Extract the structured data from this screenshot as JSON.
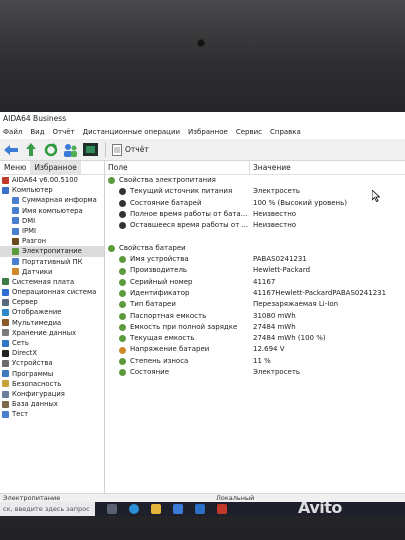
{
  "app": {
    "title": "AIDA64 Business"
  },
  "menu": [
    "Файл",
    "Вид",
    "Отчёт",
    "Дистанционные операции",
    "Избранное",
    "Сервис",
    "Справка"
  ],
  "toolbar": {
    "report_label": "Отчёт"
  },
  "columns": {
    "tab_menu": "Меню",
    "tab_favorites": "Избранное",
    "field": "Поле",
    "value": "Значение"
  },
  "tree": [
    {
      "label": "AIDA64 v6.00.5100",
      "indent": 0,
      "icon": "aida-icon",
      "color": "#c0392b"
    },
    {
      "label": "Компьютер",
      "indent": 0,
      "icon": "computer-icon",
      "color": "#3b6fc9"
    },
    {
      "label": "Суммарная информа",
      "indent": 1,
      "icon": "summary-icon",
      "color": "#4a7fd0"
    },
    {
      "label": "Имя компьютера",
      "indent": 1,
      "icon": "name-icon",
      "color": "#4a7fd0"
    },
    {
      "label": "DMI",
      "indent": 1,
      "icon": "dmi-icon",
      "color": "#4a7fd0"
    },
    {
      "label": "IPMI",
      "indent": 1,
      "icon": "ipmi-icon",
      "color": "#4a7fd0"
    },
    {
      "label": "Разгон",
      "indent": 1,
      "icon": "overclock-icon",
      "color": "#6b4a1f"
    },
    {
      "label": "Электропитание",
      "indent": 1,
      "icon": "power-icon",
      "color": "#5d9a3b",
      "selected": true
    },
    {
      "label": "Портативный ПК",
      "indent": 1,
      "icon": "laptop-icon",
      "color": "#4a7fd0"
    },
    {
      "label": "Датчики",
      "indent": 1,
      "icon": "sensor-icon",
      "color": "#d08a2a"
    },
    {
      "label": "Системная плата",
      "indent": 0,
      "icon": "motherboard-icon",
      "color": "#3d7c47"
    },
    {
      "label": "Операционная система",
      "indent": 0,
      "icon": "os-icon",
      "color": "#2f6fd6"
    },
    {
      "label": "Сервер",
      "indent": 0,
      "icon": "server-icon",
      "color": "#5a6b80"
    },
    {
      "label": "Отображение",
      "indent": 0,
      "icon": "display-icon",
      "color": "#2d88c9"
    },
    {
      "label": "Мультимедиа",
      "indent": 0,
      "icon": "multimedia-icon",
      "color": "#8a5a2a"
    },
    {
      "label": "Хранение данных",
      "indent": 0,
      "icon": "storage-icon",
      "color": "#7a7a7a"
    },
    {
      "label": "Сеть",
      "indent": 0,
      "icon": "network-icon",
      "color": "#2f77c7"
    },
    {
      "label": "DirectX",
      "indent": 0,
      "icon": "directx-icon",
      "color": "#222222"
    },
    {
      "label": "Устройства",
      "indent": 0,
      "icon": "devices-icon",
      "color": "#6b6b6b"
    },
    {
      "label": "Программы",
      "indent": 0,
      "icon": "programs-icon",
      "color": "#3d7bbf"
    },
    {
      "label": "Безопасность",
      "indent": 0,
      "icon": "security-icon",
      "color": "#c7a43a"
    },
    {
      "label": "Конфигурация",
      "indent": 0,
      "icon": "config-icon",
      "color": "#6a7f9a"
    },
    {
      "label": "База данных",
      "indent": 0,
      "icon": "database-icon",
      "color": "#7a6a4a"
    },
    {
      "label": "Тест",
      "indent": 0,
      "icon": "test-icon",
      "color": "#4a7fd0"
    }
  ],
  "rows": [
    {
      "type": "group",
      "field": "Свойства электропитания",
      "value": "",
      "icon": "power-props-icon",
      "color": "#5d9a3b"
    },
    {
      "type": "item",
      "field": "Текущий источник питания",
      "value": "Электросеть",
      "icon": "plug-icon",
      "color": "#333333"
    },
    {
      "type": "item",
      "field": "Состояние батарей",
      "value": "100 % (Высокий уровень)",
      "icon": "battery-icon",
      "color": "#333333"
    },
    {
      "type": "item",
      "field": "Полное время работы от бата...",
      "value": "Неизвестно",
      "icon": "battery-time-icon",
      "color": "#333333"
    },
    {
      "type": "item",
      "field": "Оставшееся время работы от ...",
      "value": "Неизвестно",
      "icon": "battery-remaining-icon",
      "color": "#333333"
    },
    {
      "type": "spacer",
      "field": "",
      "value": ""
    },
    {
      "type": "group",
      "field": "Свойства батареи",
      "value": "",
      "icon": "battery-props-icon",
      "color": "#5d9a3b"
    },
    {
      "type": "item",
      "field": "Имя устройства",
      "value": "PABAS0241231",
      "icon": "device-name-icon",
      "color": "#5d9a3b"
    },
    {
      "type": "item",
      "field": "Производитель",
      "value": "Hewlett-Packard",
      "icon": "manufacturer-icon",
      "color": "#5d9a3b"
    },
    {
      "type": "item",
      "field": "Серийный номер",
      "value": "41167",
      "icon": "serial-icon",
      "color": "#5d9a3b"
    },
    {
      "type": "item",
      "field": "Идентификатор",
      "value": "41167Hewlett-PackardPABAS0241231",
      "icon": "id-icon",
      "color": "#5d9a3b"
    },
    {
      "type": "item",
      "field": "Тип батареи",
      "value": "Перезаряжаемая Li-Ion",
      "icon": "battery-type-icon",
      "color": "#5d9a3b"
    },
    {
      "type": "item",
      "field": "Паспортная емкость",
      "value": "31080 mWh",
      "icon": "design-capacity-icon",
      "color": "#5d9a3b"
    },
    {
      "type": "item",
      "field": "Емкость при полной зарядке",
      "value": "27484 mWh",
      "icon": "full-capacity-icon",
      "color": "#5d9a3b"
    },
    {
      "type": "item",
      "field": "Текущая емкость",
      "value": "27484 mWh  (100 %)",
      "icon": "current-capacity-icon",
      "color": "#5d9a3b"
    },
    {
      "type": "item",
      "field": "Напряжение батареи",
      "value": "12.694 V",
      "icon": "voltage-icon",
      "color": "#d08a2a"
    },
    {
      "type": "item",
      "field": "Степень износа",
      "value": "11 %",
      "icon": "wear-icon",
      "color": "#5d9a3b"
    },
    {
      "type": "item",
      "field": "Состояние",
      "value": "Электросеть",
      "icon": "state-icon",
      "color": "#5d9a3b"
    }
  ],
  "status": {
    "left": "Электропитание",
    "mid": "Локальный"
  },
  "taskbar": {
    "search_placeholder": "ск, введите здесь запрос"
  },
  "watermark": "Avito"
}
